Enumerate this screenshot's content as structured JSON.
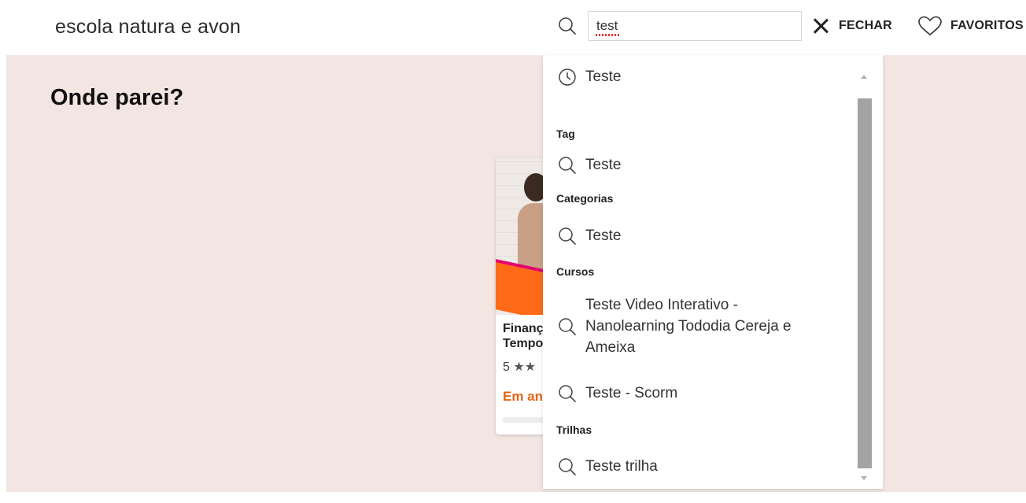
{
  "header": {
    "brand": "escola natura e avon",
    "search": {
      "value": "test",
      "placeholder": ""
    },
    "close_label": "FECHAR",
    "favorites_label": "FAVORITOS"
  },
  "main": {
    "section_title": "Onde parei?",
    "card": {
      "title": "Finanç\nTempo",
      "rating": "5",
      "stars_visible": 2,
      "status": "Em an"
    }
  },
  "dropdown": {
    "recent": {
      "label": "Teste",
      "icon": "clock-icon"
    },
    "groups": [
      {
        "heading": "Tag",
        "items": [
          "Teste"
        ]
      },
      {
        "heading": "Categorias",
        "items": [
          "Teste"
        ]
      },
      {
        "heading": "Cursos",
        "items": [
          "Teste Video Interativo - Nanolearning Tododia Cereja e Ameixa",
          "Teste - Scorm"
        ]
      },
      {
        "heading": "Trilhas",
        "items": [
          "Teste trilha"
        ]
      }
    ]
  },
  "colors": {
    "band": "#f3e6e2",
    "accent_orange": "#e36414",
    "scrollbar": "#a3a3a3"
  }
}
